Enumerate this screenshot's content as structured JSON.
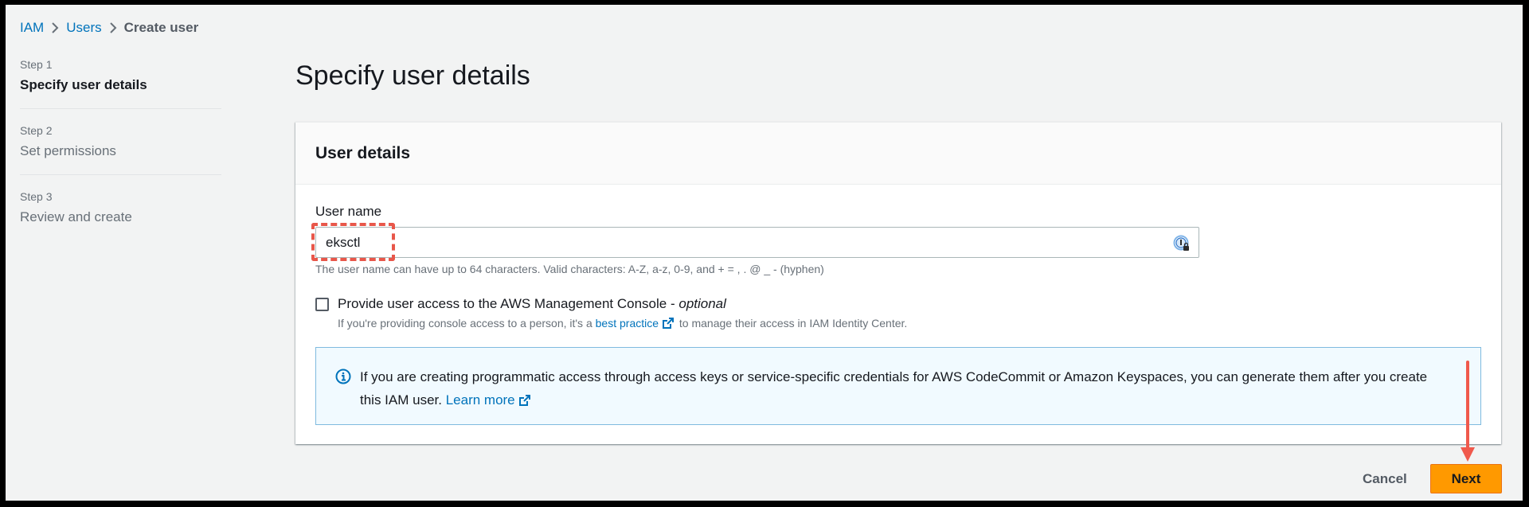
{
  "breadcrumb": [
    {
      "label": "IAM",
      "link": true
    },
    {
      "label": "Users",
      "link": true
    },
    {
      "label": "Create user",
      "link": false
    }
  ],
  "steps": [
    {
      "number": "Step 1",
      "title": "Specify user details",
      "active": true
    },
    {
      "number": "Step 2",
      "title": "Set permissions",
      "active": false
    },
    {
      "number": "Step 3",
      "title": "Review and create",
      "active": false
    }
  ],
  "page_title": "Specify user details",
  "user_details": {
    "header": "User details",
    "username_label": "User name",
    "username_value": "eksctl",
    "username_constraint": "The user name can have up to 64 characters. Valid characters: A-Z, a-z, 0-9, and + = , . @ _ - (hyphen)",
    "password_manager_icon": "password-manager-icon",
    "console_access": {
      "checked": false,
      "label": "Provide user access to the AWS Management Console - ",
      "label_optional": "optional",
      "desc_prefix": "If you're providing console access to a person, it's a ",
      "desc_link": "best practice",
      "desc_suffix": " to manage their access in IAM Identity Center."
    },
    "info_alert": {
      "icon": "info-icon",
      "text": "If you are creating programmatic access through access keys or service-specific credentials for AWS CodeCommit or Amazon Keyspaces, you can generate them after you create this IAM user. ",
      "link": "Learn more"
    }
  },
  "actions": {
    "cancel_label": "Cancel",
    "next_label": "Next"
  },
  "annotations": {
    "highlight_color": "#e8574a",
    "arrow_target": "Next"
  },
  "colors": {
    "link": "#0073bb",
    "primary_button": "#ff9900",
    "background": "#f2f3f3"
  }
}
